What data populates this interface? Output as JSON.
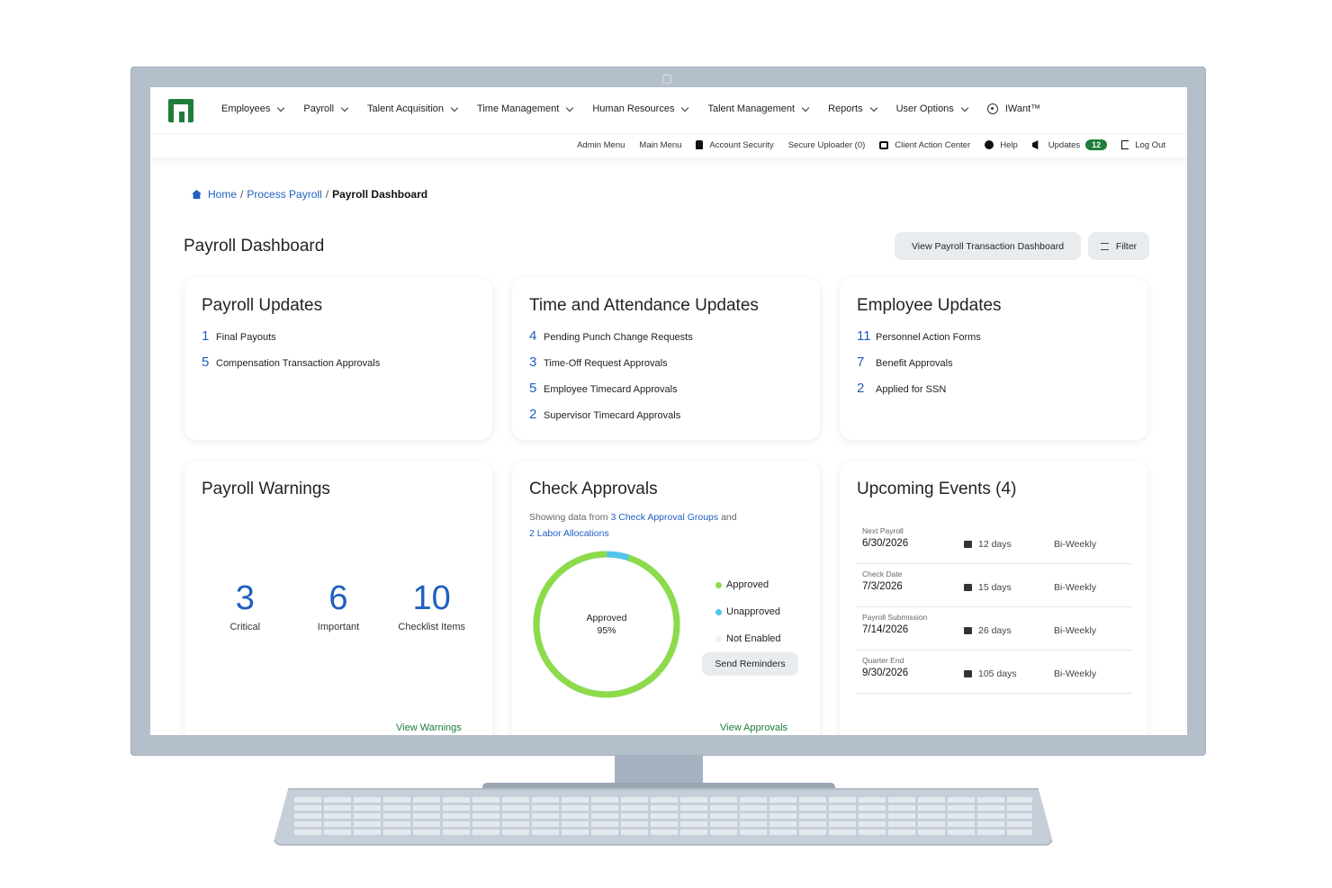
{
  "nav": {
    "items": [
      {
        "label": "Employees"
      },
      {
        "label": "Payroll"
      },
      {
        "label": "Talent Acquisition"
      },
      {
        "label": "Time Management"
      },
      {
        "label": "Human Resources"
      },
      {
        "label": "Talent Management"
      },
      {
        "label": "Reports"
      },
      {
        "label": "User Options"
      }
    ],
    "iwant": "IWant™"
  },
  "util": {
    "admin_menu": "Admin Menu",
    "main_menu": "Main Menu",
    "account_security": "Account Security",
    "secure_uploader": "Secure Uploader (0)",
    "client_action_center": "Client Action Center",
    "help": "Help",
    "updates": "Updates",
    "updates_count": "12",
    "log_out": "Log Out"
  },
  "breadcrumb": {
    "home": "Home",
    "process_payroll": "Process Payroll",
    "current": "Payroll Dashboard",
    "sep": "/"
  },
  "page": {
    "title": "Payroll Dashboard",
    "transaction_button": "View Payroll Transaction Dashboard",
    "filter_button": "Filter"
  },
  "payroll_updates": {
    "title": "Payroll Updates",
    "items": [
      {
        "count": "1",
        "label": "Final Payouts"
      },
      {
        "count": "5",
        "label": "Compensation Transaction Approvals"
      }
    ]
  },
  "time_updates": {
    "title": "Time and Attendance Updates",
    "items": [
      {
        "count": "4",
        "label": "Pending Punch Change Requests"
      },
      {
        "count": "3",
        "label": "Time-Off Request Approvals"
      },
      {
        "count": "5",
        "label": "Employee Timecard Approvals"
      },
      {
        "count": "2",
        "label": "Supervisor Timecard Approvals"
      }
    ]
  },
  "employee_updates": {
    "title": "Employee Updates",
    "items": [
      {
        "count": "11",
        "label": "Personnel Action Forms"
      },
      {
        "count": "7",
        "label": "Benefit Approvals"
      },
      {
        "count": "2",
        "label": "Applied for SSN"
      }
    ]
  },
  "warnings": {
    "title": "Payroll Warnings",
    "stats": [
      {
        "count": "3",
        "label": "Critical"
      },
      {
        "count": "6",
        "label": "Important"
      },
      {
        "count": "10",
        "label": "Checklist Items"
      }
    ],
    "link": "View Warnings"
  },
  "check_approvals": {
    "title": "Check Approvals",
    "sub_prefix": "Showing data from",
    "groups_link": "3 Check Approval Groups",
    "sub_and": "and",
    "labor_link": "2 Labor Allocations",
    "donut_label": "Approved",
    "donut_percent": "95%",
    "approved_fraction": 0.95,
    "legend": [
      "Approved",
      "Unapproved",
      "Not Enabled"
    ],
    "colors": {
      "approved": "#8edb4a",
      "unapproved": "#52c3e8",
      "not_enabled": "#eeeeee"
    },
    "send_button": "Send Reminders",
    "link": "View Approvals"
  },
  "events": {
    "title": "Upcoming Events (4)",
    "items": [
      {
        "name": "Next Payroll",
        "date": "6/30/2026",
        "days": "12 days",
        "freq": "Bi-Weekly"
      },
      {
        "name": "Check Date",
        "date": "7/3/2026",
        "days": "15 days",
        "freq": "Bi-Weekly"
      },
      {
        "name": "Payroll Submission",
        "date": "7/14/2026",
        "days": "26 days",
        "freq": "Bi-Weekly"
      },
      {
        "name": "Quarter End",
        "date": "9/30/2026",
        "days": "105 days",
        "freq": "Bi-Weekly"
      }
    ]
  },
  "colors": {
    "brand_green": "#1e7d3a",
    "link_blue": "#1f5fbf"
  }
}
